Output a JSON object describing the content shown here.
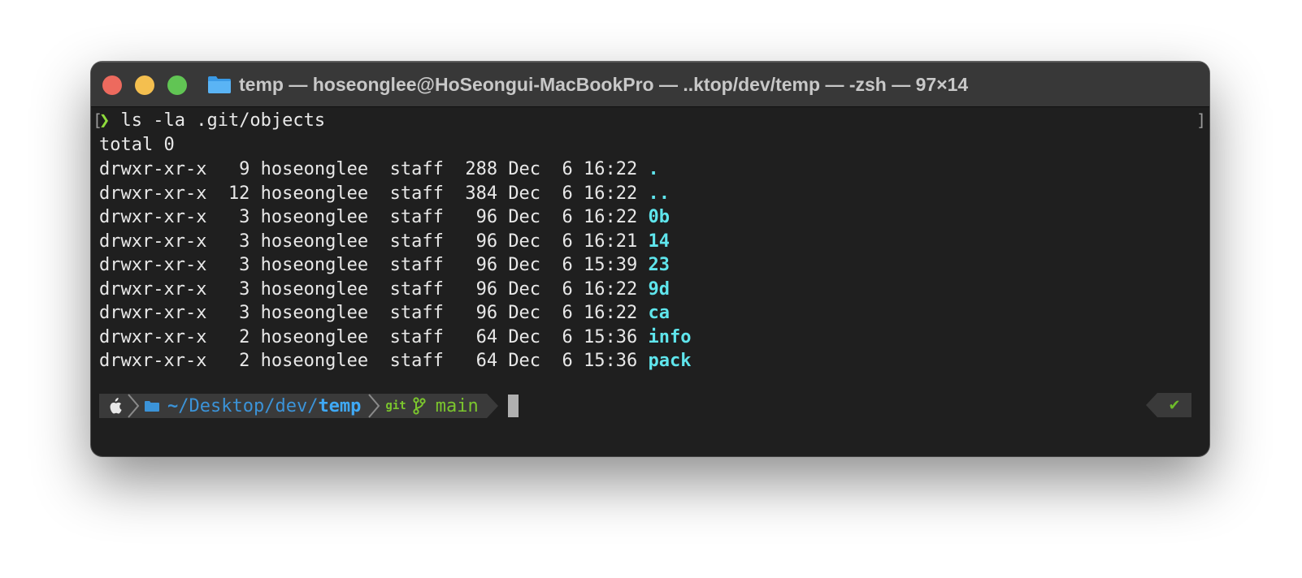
{
  "window": {
    "title": "temp — hoseonglee@HoSeongui-MacBookPro — ..ktop/dev/temp — -zsh — 97×14",
    "folder_icon": "folder-icon",
    "traffic_lights": {
      "close": "#ed6a5e",
      "minimize": "#f4bf4f",
      "maximize": "#61c554"
    }
  },
  "terminal": {
    "bracket_left": "[",
    "bracket_right": "]",
    "command": {
      "prompt_symbol": "❯",
      "text": " ls -la .git/objects"
    },
    "total": "total 0",
    "rows": [
      {
        "meta": "drwxr-xr-x   9 hoseonglee  staff  288 Dec  6 16:22 ",
        "name": "."
      },
      {
        "meta": "drwxr-xr-x  12 hoseonglee  staff  384 Dec  6 16:22 ",
        "name": ".."
      },
      {
        "meta": "drwxr-xr-x   3 hoseonglee  staff   96 Dec  6 16:22 ",
        "name": "0b"
      },
      {
        "meta": "drwxr-xr-x   3 hoseonglee  staff   96 Dec  6 16:21 ",
        "name": "14"
      },
      {
        "meta": "drwxr-xr-x   3 hoseonglee  staff   96 Dec  6 15:39 ",
        "name": "23"
      },
      {
        "meta": "drwxr-xr-x   3 hoseonglee  staff   96 Dec  6 16:22 ",
        "name": "9d"
      },
      {
        "meta": "drwxr-xr-x   3 hoseonglee  staff   96 Dec  6 16:22 ",
        "name": "ca"
      },
      {
        "meta": "drwxr-xr-x   2 hoseonglee  staff   64 Dec  6 15:36 ",
        "name": "info"
      },
      {
        "meta": "drwxr-xr-x   2 hoseonglee  staff   64 Dec  6 15:36 ",
        "name": "pack"
      }
    ],
    "prompt": {
      "os_icon": "apple-icon",
      "dir_icon": "folder-icon",
      "path_home": "~",
      "path_middle": "/Desktop/dev/",
      "path_leaf": "temp",
      "git_label": "git",
      "branch_icon": "git-branch-icon",
      "branch": "main",
      "status": "✔"
    },
    "colors": {
      "dir_name": "#5fe5ec",
      "prompt_arrow": "#8fdc3c",
      "path": "#3b93d8",
      "git": "#7bc62d"
    }
  }
}
